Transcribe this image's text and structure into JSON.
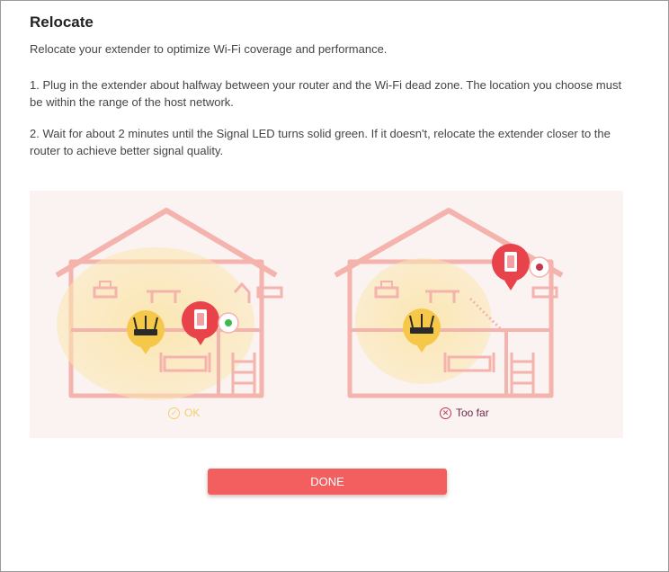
{
  "dialog": {
    "title": "Relocate",
    "paragraphs": [
      "Relocate your extender to optimize Wi-Fi coverage and performance.",
      "1. Plug in the extender about halfway between your router and the Wi-Fi dead zone. The location you choose must be within the range of the host network.",
      "2. Wait for about 2 minutes until the Signal LED turns solid green. If it doesn't, relocate the extender closer to the router to achieve better signal quality."
    ],
    "illustration": {
      "ok": {
        "label": "OK",
        "icon": "check-circle-icon",
        "color": "#f5cf6a"
      },
      "too_far": {
        "label": "Too far",
        "icon": "x-circle-icon",
        "color": "#c0394e"
      }
    },
    "done_label": "DONE"
  },
  "colors": {
    "accent": "#f35e5f",
    "house_line": "#f4b3ad",
    "coverage": "#fbe8b5",
    "router_badge": "#f6c84a",
    "extender_badge": "#e8424b",
    "led_ok": "#3dbb4a",
    "led_bad": "#c0394e"
  }
}
